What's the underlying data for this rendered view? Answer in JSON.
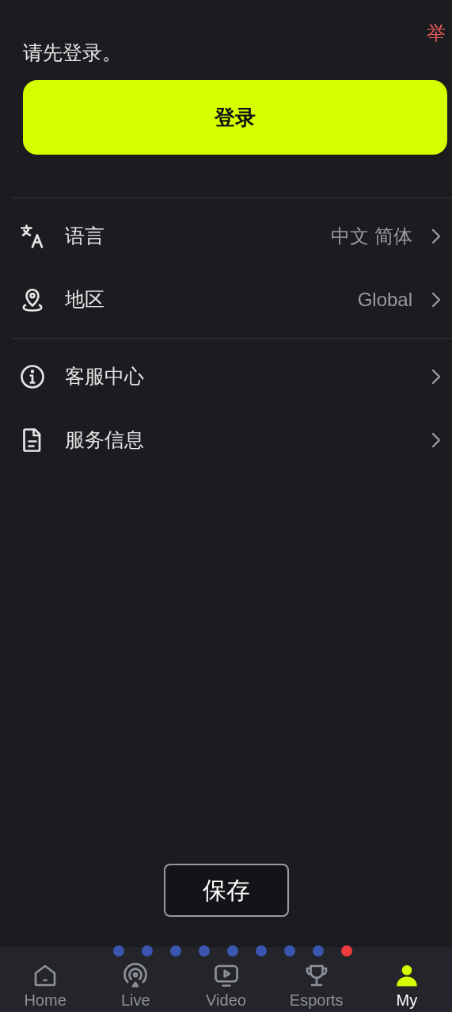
{
  "report_link": "举",
  "login_prompt": "请先登录。",
  "login_button": "登录",
  "settings_groups": [
    {
      "items": [
        {
          "kind": "language",
          "label": "语言",
          "value": "中文 简体"
        },
        {
          "kind": "region",
          "label": "地区",
          "value": "Global"
        }
      ]
    },
    {
      "items": [
        {
          "kind": "info",
          "label": "客服中心"
        },
        {
          "kind": "document",
          "label": "服务信息"
        }
      ]
    }
  ],
  "save_button": "保存",
  "page_dots": [
    {
      "color": "#3a56b0"
    },
    {
      "color": "#3a56b0"
    },
    {
      "color": "#3a56b0"
    },
    {
      "color": "#3a56b0"
    },
    {
      "color": "#3a56b0"
    },
    {
      "color": "#3a56b0"
    },
    {
      "color": "#3a56b0"
    },
    {
      "color": "#3a56b0"
    },
    {
      "color": "#ee3b3b"
    }
  ],
  "tab_bar": [
    {
      "kind": "home",
      "label": "Home",
      "selected": false
    },
    {
      "kind": "live",
      "label": "Live",
      "selected": false
    },
    {
      "kind": "video",
      "label": "Video",
      "selected": false
    },
    {
      "kind": "trophy",
      "label": "Esports",
      "selected": false
    },
    {
      "kind": "user",
      "label": "My",
      "selected": true
    }
  ]
}
